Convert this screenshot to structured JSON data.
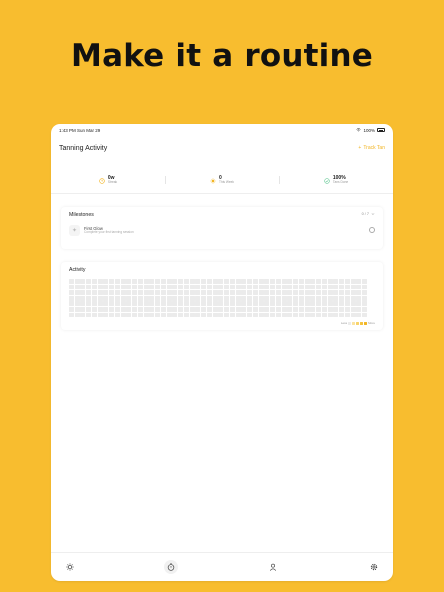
{
  "headline": "Make it a routine",
  "status": {
    "time": "1:43 PM",
    "date": "Sun Mar 29",
    "battery": "100%"
  },
  "header": {
    "title": "Tanning Activity",
    "track_button": "Track Tan",
    "track_icon": "+"
  },
  "stats": [
    {
      "icon": "clock-icon",
      "value": "0w",
      "label": "Streak",
      "color": "#F2B524"
    },
    {
      "icon": "sun-icon",
      "value": "0",
      "label": "This Week",
      "color": "#F2B524"
    },
    {
      "icon": "check-icon",
      "value": "100%",
      "label": "Tans Done",
      "color": "#6BCB9A"
    }
  ],
  "milestones": {
    "title": "Milestones",
    "filter": "0 / 7",
    "items": [
      {
        "name": "First Glow",
        "description": "Complete your first tanning session"
      }
    ]
  },
  "activity": {
    "title": "Activity",
    "rows": 7,
    "cols": 52,
    "legend_less": "Less",
    "legend_more": "More",
    "legend_colors": [
      "#ebebeb",
      "#FBE3A0",
      "#F8D36A",
      "#F5C23D",
      "#F2B524"
    ]
  },
  "tabs": [
    {
      "name": "tab-sun",
      "icon": "sun-icon",
      "active": false
    },
    {
      "name": "tab-timer",
      "icon": "timer-icon",
      "active": true
    },
    {
      "name": "tab-profile",
      "icon": "person-icon",
      "active": false
    },
    {
      "name": "tab-settings",
      "icon": "gear-icon",
      "active": false
    }
  ],
  "colors": {
    "background": "#F8BD2F",
    "accent": "#F2B524"
  }
}
